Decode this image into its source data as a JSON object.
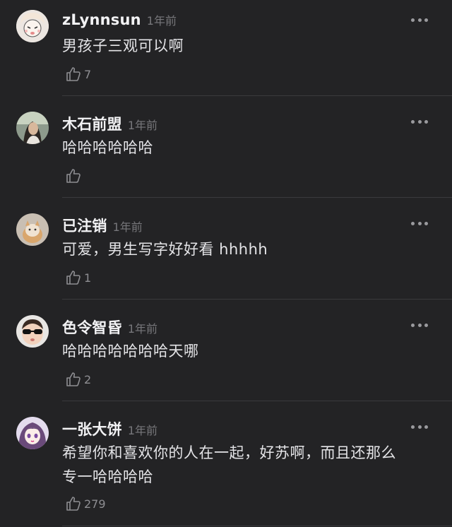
{
  "comments": [
    {
      "username": "zLynnsun",
      "time": "1年前",
      "text": "男孩子三观可以啊",
      "likes": "7",
      "avatar": "cartoon-girl-avatar"
    },
    {
      "username": "木石前盟",
      "time": "1年前",
      "text": "哈哈哈哈哈哈",
      "likes": "",
      "avatar": "person-photo-avatar"
    },
    {
      "username": "已注销",
      "time": "1年前",
      "text": "可爱，男生写字好好看 hhhhh",
      "likes": "1",
      "avatar": "cat-photo-avatar"
    },
    {
      "username": "色令智昏",
      "time": "1年前",
      "text": "哈哈哈哈哈哈哈天哪",
      "likes": "2",
      "avatar": "baby-sunglasses-avatar"
    },
    {
      "username": "一张大饼",
      "time": "1年前",
      "text_line1": "希望你和喜欢你的人在一起，好苏啊，而且还那么",
      "text_line2": "专一哈哈哈哈",
      "likes": "279",
      "avatar": "anime-girl-avatar"
    }
  ],
  "icons": {
    "more": "more-dots-icon",
    "like": "thumbs-up-icon"
  }
}
